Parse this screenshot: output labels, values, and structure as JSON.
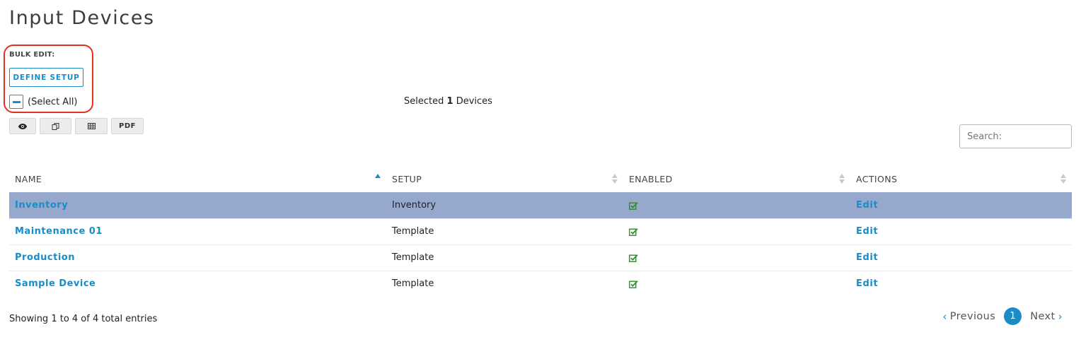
{
  "page": {
    "title": "Input Devices"
  },
  "bulk_edit": {
    "label": "BULK EDIT:",
    "define_setup_label": "DEFINE SETUP",
    "select_all_label": "(Select All)",
    "select_all_state": "indeterminate"
  },
  "selection": {
    "prefix": "Selected",
    "count": "1",
    "suffix": "Devices"
  },
  "toolbar": {
    "buttons": [
      {
        "icon": "eye-icon"
      },
      {
        "icon": "copy-icon"
      },
      {
        "icon": "spreadsheet-icon"
      },
      {
        "label": "PDF"
      }
    ]
  },
  "search": {
    "placeholder": "Search:",
    "value": ""
  },
  "table": {
    "columns": [
      "NAME",
      "SETUP",
      "ENABLED",
      "ACTIONS"
    ],
    "sorted_column": "NAME",
    "sort_direction": "ascending",
    "rows": [
      {
        "name": "Inventory",
        "setup": "Inventory",
        "enabled": true,
        "action": "Edit",
        "selected": true
      },
      {
        "name": "Maintenance 01",
        "setup": "Template",
        "enabled": true,
        "action": "Edit",
        "selected": false
      },
      {
        "name": "Production",
        "setup": "Template",
        "enabled": true,
        "action": "Edit",
        "selected": false
      },
      {
        "name": "Sample Device",
        "setup": "Template",
        "enabled": true,
        "action": "Edit",
        "selected": false
      }
    ]
  },
  "footer": {
    "showing": "Showing 1 to 4 of 4 total entries",
    "pagination": {
      "previous": "Previous",
      "current_page": "1",
      "next": "Next"
    }
  },
  "colors": {
    "accent": "#1a8cc8",
    "selected_row": "#97a8cd",
    "highlight_outline": "#e2311d",
    "check_green": "#2e8b2e"
  }
}
